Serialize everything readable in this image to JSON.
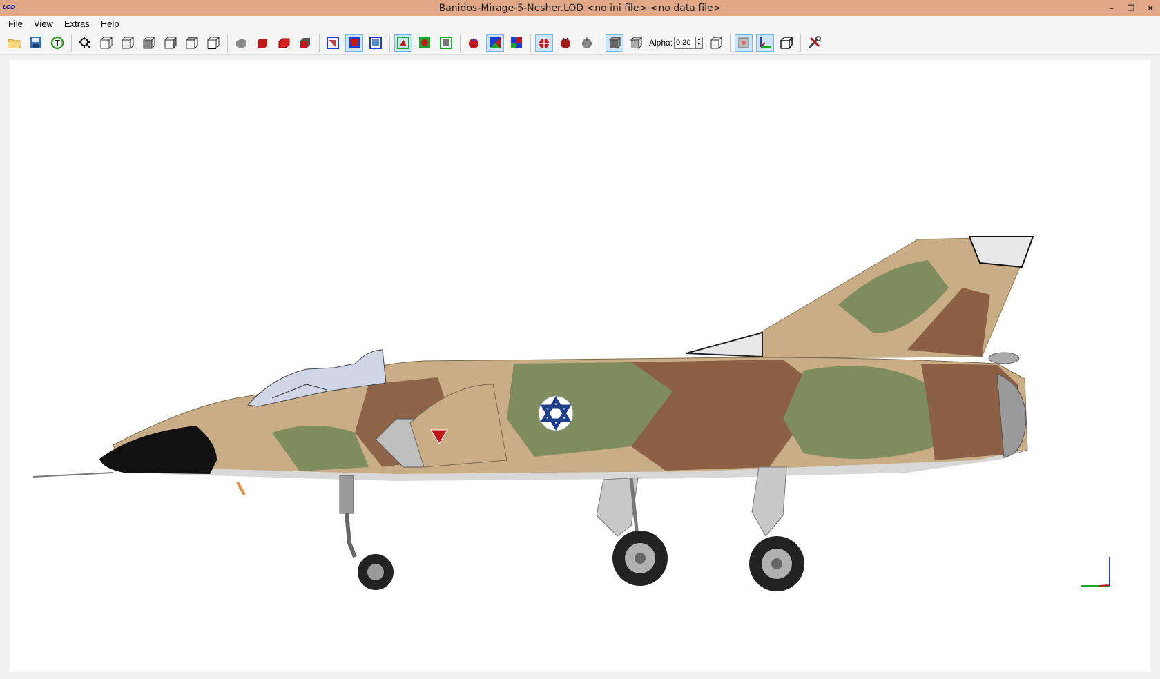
{
  "app": {
    "icon_text": "LOD",
    "title": "Banidos-Mirage-5-Nesher.LOD  <no ini file>  <no data file>"
  },
  "window_controls": [
    "minimize",
    "restore",
    "close"
  ],
  "menu": {
    "items": [
      "File",
      "View",
      "Extras",
      "Help"
    ]
  },
  "toolbar": {
    "alpha_label": "Alpha:",
    "alpha_value": "0.20",
    "icons": [
      "open-folder-icon",
      "save-icon",
      "reload-icon",
      "zoom-fit-icon",
      "view-front-icon",
      "view-back-icon",
      "view-left-icon",
      "view-right-icon",
      "view-top-icon",
      "view-bottom-icon",
      "smooth-shade-icon",
      "solid-red-icon",
      "red-shaded-icon",
      "red-cube-icon",
      "wireframe-blue-icon",
      "solid-blue-icon",
      "blue-box-icon",
      "wireframe-green-icon",
      "solid-green-icon",
      "green-box-icon",
      "color-model-icon",
      "textured-icon",
      "multicolor-icon",
      "bug-red-icon",
      "bug-dark-icon",
      "bug-gray-icon",
      "cube-dark-icon",
      "cube-light-icon",
      "box-outline-icon",
      "bounding-box-icon",
      "axes-icon",
      "cube-outline-icon",
      "settings-tools-icon"
    ]
  },
  "colors": {
    "titlebar": "#e0a887",
    "camo_sand": "#c9ad86",
    "camo_brown": "#8b6045",
    "camo_green": "#7f8c5e",
    "roundel_blue": "#1e3f8c"
  }
}
